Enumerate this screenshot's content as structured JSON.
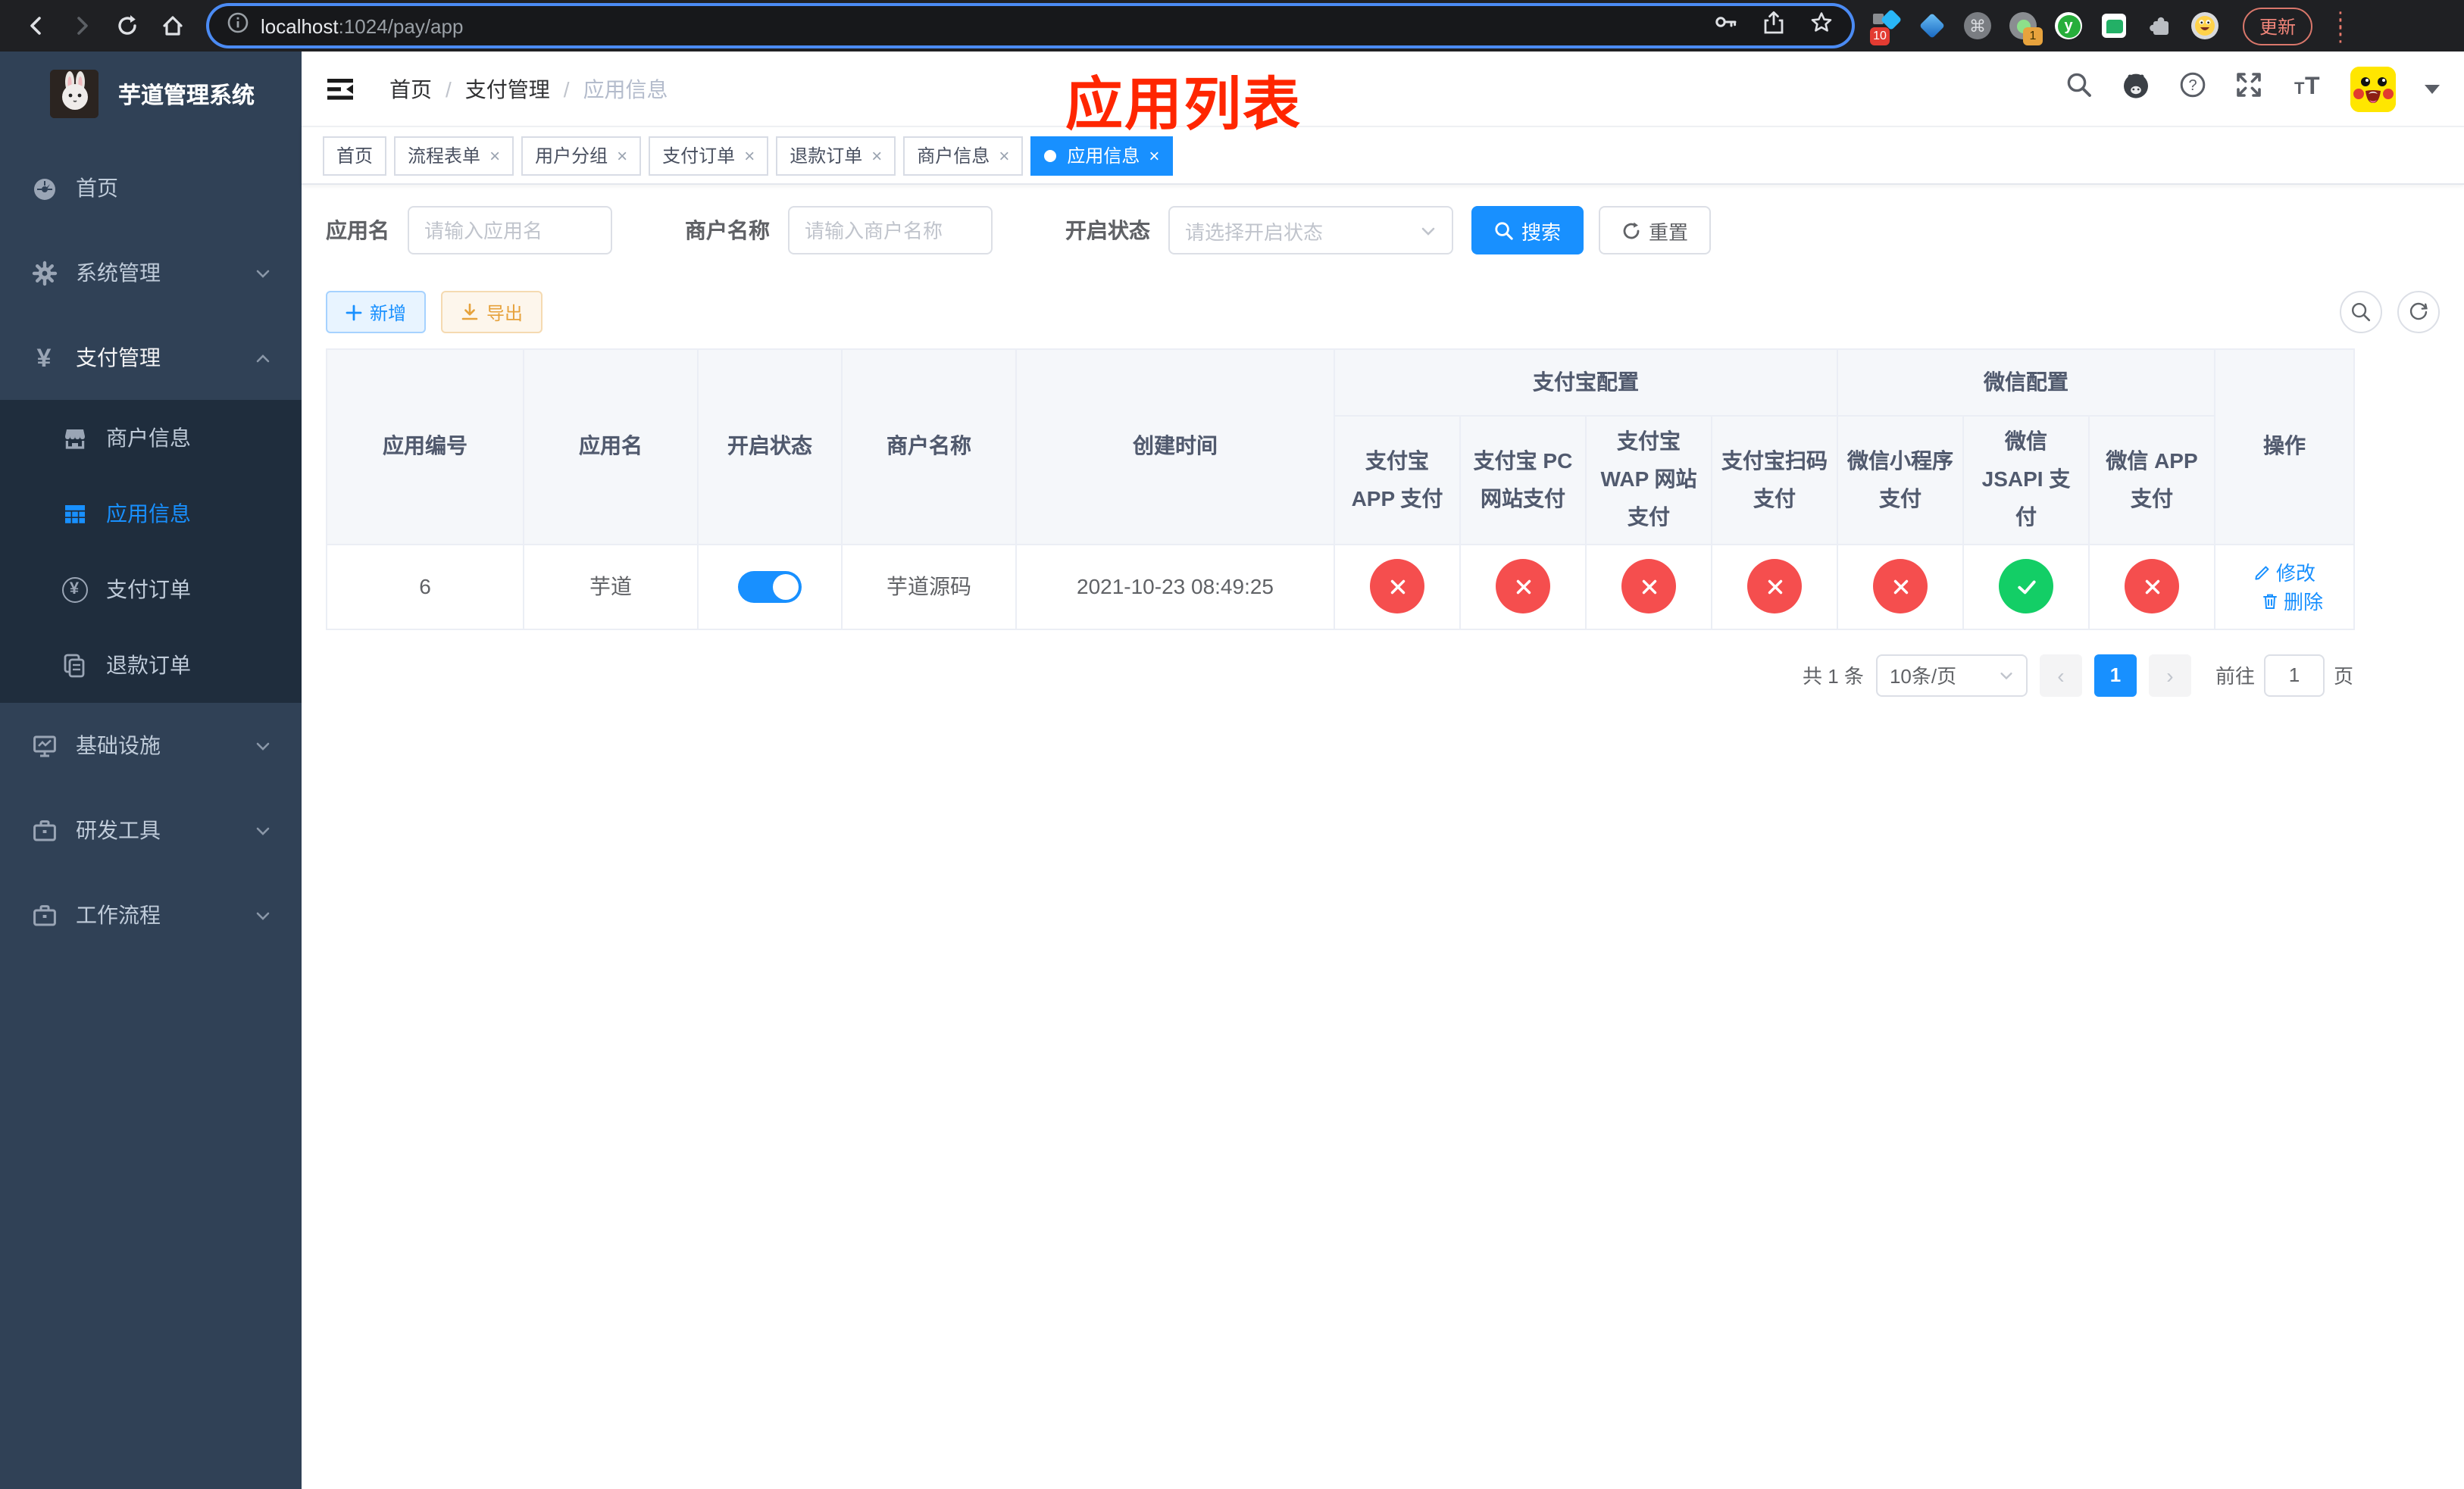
{
  "colors": {
    "accent": "#1890ff",
    "success": "#13ce66",
    "danger": "#f54e4e",
    "annotation_red": "#ff2600",
    "sidebar_bg": "#304156",
    "submenu_bg": "#1f2d3d"
  },
  "browser": {
    "url": {
      "host": "localhost",
      "rest": ":1024/pay/app"
    },
    "extension_badge_1": "10",
    "extension_badge_2": "1",
    "update_label": "更新"
  },
  "sidebar": {
    "logo_title": "芋道管理系统",
    "menu": [
      {
        "label": "首页",
        "icon": "dashboard-icon"
      },
      {
        "label": "系统管理",
        "icon": "gear-icon",
        "chevron": "down"
      },
      {
        "label": "支付管理",
        "icon": "yen-icon",
        "chevron": "up",
        "active": true
      },
      {
        "label": "基础设施",
        "icon": "monitor-icon",
        "chevron": "down"
      },
      {
        "label": "研发工具",
        "icon": "briefcase-icon",
        "chevron": "down"
      },
      {
        "label": "工作流程",
        "icon": "briefcase-icon",
        "chevron": "down"
      }
    ],
    "submenu": [
      {
        "label": "商户信息",
        "icon": "store-icon"
      },
      {
        "label": "应用信息",
        "icon": "grid-icon",
        "active": true
      },
      {
        "label": "支付订单",
        "icon": "yen-circle-icon"
      },
      {
        "label": "退款订单",
        "icon": "document-icon"
      }
    ]
  },
  "navbar": {
    "breadcrumb": [
      "首页",
      "支付管理",
      "应用信息"
    ]
  },
  "annotation": {
    "text": "应用列表"
  },
  "tabs": [
    {
      "label": "首页",
      "closable": false,
      "active": false
    },
    {
      "label": "流程表单",
      "closable": true,
      "active": false
    },
    {
      "label": "用户分组",
      "closable": true,
      "active": false
    },
    {
      "label": "支付订单",
      "closable": true,
      "active": false
    },
    {
      "label": "退款订单",
      "closable": true,
      "active": false
    },
    {
      "label": "商户信息",
      "closable": true,
      "active": false
    },
    {
      "label": "应用信息",
      "closable": true,
      "active": true
    }
  ],
  "filters": {
    "app_name_label": "应用名",
    "app_name_placeholder": "请输入应用名",
    "merchant_label": "商户名称",
    "merchant_placeholder": "请输入商户名称",
    "status_label": "开启状态",
    "status_placeholder": "请选择开启状态",
    "search_label": "搜索",
    "reset_label": "重置"
  },
  "toolbar": {
    "add_label": "新增",
    "export_label": "导出"
  },
  "table": {
    "columns": [
      "应用编号",
      "应用名",
      "开启状态",
      "商户名称",
      "创建时间"
    ],
    "groups": [
      {
        "label": "支付宝配置",
        "children": [
          "支付宝 APP 支付",
          "支付宝 PC 网站支付",
          "支付宝 WAP 网站支付",
          "支付宝扫码支付"
        ]
      },
      {
        "label": "微信配置",
        "children": [
          "微信小程序支付",
          "微信 JSAPI 支付",
          "微信 APP 支付"
        ]
      }
    ],
    "ops_label": "操作",
    "row": {
      "id": "6",
      "name": "芋道",
      "enabled": true,
      "merchant": "芋道源码",
      "created": "2021-10-23 08:49:25",
      "statuses": [
        "fail",
        "fail",
        "fail",
        "fail",
        "fail",
        "ok",
        "fail"
      ],
      "edit_label": "修改",
      "delete_label": "删除"
    }
  },
  "pagination": {
    "total": "共 1 条",
    "page_size": "10条/页",
    "page": "1",
    "goto_prefix": "前往",
    "goto_value": "1",
    "goto_suffix": "页"
  }
}
